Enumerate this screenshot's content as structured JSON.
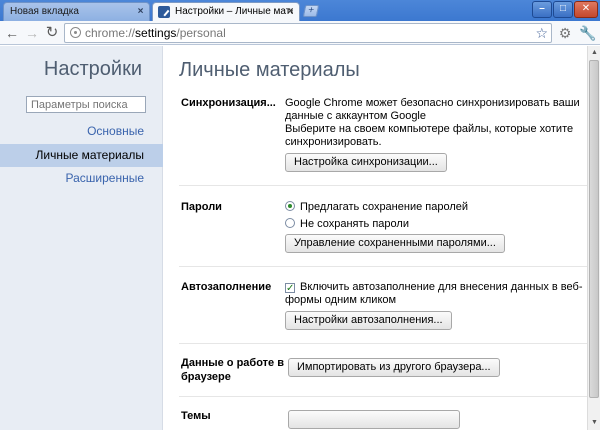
{
  "tabs": [
    {
      "label": "Новая вкладка",
      "active": false
    },
    {
      "label": "Настройки – Личные материалы",
      "active": true
    }
  ],
  "window_buttons": [
    "minimize",
    "maximize",
    "close"
  ],
  "toolbar": {
    "url_scheme": "chrome://",
    "url_host": "settings",
    "url_path": "/personal",
    "icons": [
      "back-icon",
      "forward-icon",
      "reload-icon",
      "bookmark-star-icon",
      "gear-icon",
      "wrench-icon"
    ]
  },
  "sidebar": {
    "title": "Настройки",
    "search_placeholder": "Параметры поиска",
    "items": [
      {
        "label": "Основные",
        "selected": false
      },
      {
        "label": "Личные материалы",
        "selected": true
      },
      {
        "label": "Расширенные",
        "selected": false
      }
    ]
  },
  "main": {
    "title": "Личные материалы",
    "sync": {
      "label": "Синхронизация...",
      "desc1": "Google Chrome может безопасно синхронизировать ваши данные с аккаунтом Google",
      "desc2": "Выберите на своем компьютере файлы, которые хотите синхронизировать.",
      "button": "Настройка синхронизации..."
    },
    "passwords": {
      "label": "Пароли",
      "option_offer": "Предлагать сохранение паролей",
      "option_never": "Не сохранять пароли",
      "selected": "option_offer",
      "button": "Управление сохраненными паролями..."
    },
    "autofill": {
      "label": "Автозаполнение",
      "checkbox_label": "Включить автозаполнение для внесения данных в веб-формы одним кликом",
      "checked": true,
      "button": "Настройки автозаполнения..."
    },
    "browsing_data": {
      "label": "Данные о работе в браузере",
      "button": "Импортировать из другого браузера..."
    },
    "themes": {
      "label": "Темы"
    }
  },
  "colors": {
    "tabstrip": "#3c78d0",
    "sidebar_bg": "#e8edf4",
    "selected_nav": "#bccfe9",
    "link": "#3a64ad",
    "title": "#4f5e71"
  }
}
